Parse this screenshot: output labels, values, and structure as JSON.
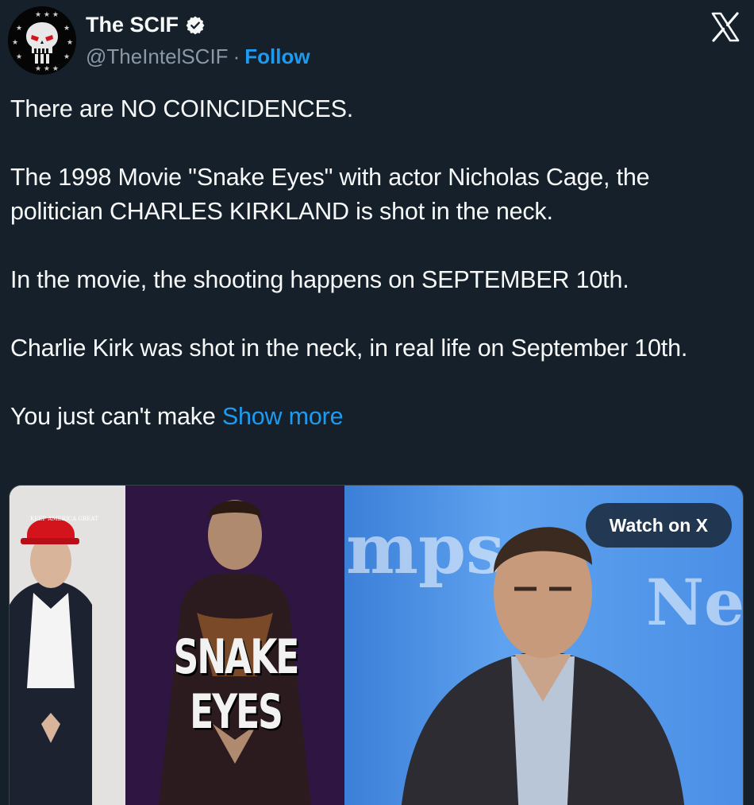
{
  "author": {
    "display_name": "The SCIF",
    "handle": "@TheIntelSCIF",
    "separator": "·",
    "follow_label": "Follow"
  },
  "tweet": {
    "paragraphs": [
      "There are NO COINCIDENCES.",
      "The 1998 Movie \"Snake Eyes\" with actor Nicholas Cage, the politician CHARLES KIRKLAND is shot in the neck.",
      "In the movie, the shooting happens on SEPTEMBER 10th.",
      "Charlie Kirk was shot in the neck, in real life on September 10th."
    ],
    "truncated_text": "You just can't make",
    "show_more_label": "Show more"
  },
  "media": {
    "watch_label": "Watch on X",
    "movie_title": "SNAKE EYES",
    "hat_text": "KEEP AMERICA GREAT",
    "backdrop_text_left": "mps",
    "backdrop_text_right": "Ne"
  },
  "icons": {
    "avatar": "skull-avatar-icon",
    "verified": "verified-badge-icon",
    "platform": "x-logo-icon"
  },
  "colors": {
    "background": "#15202b",
    "text": "#f7f9f9",
    "secondary_text": "#8b98a5",
    "accent": "#1d9bf0"
  }
}
